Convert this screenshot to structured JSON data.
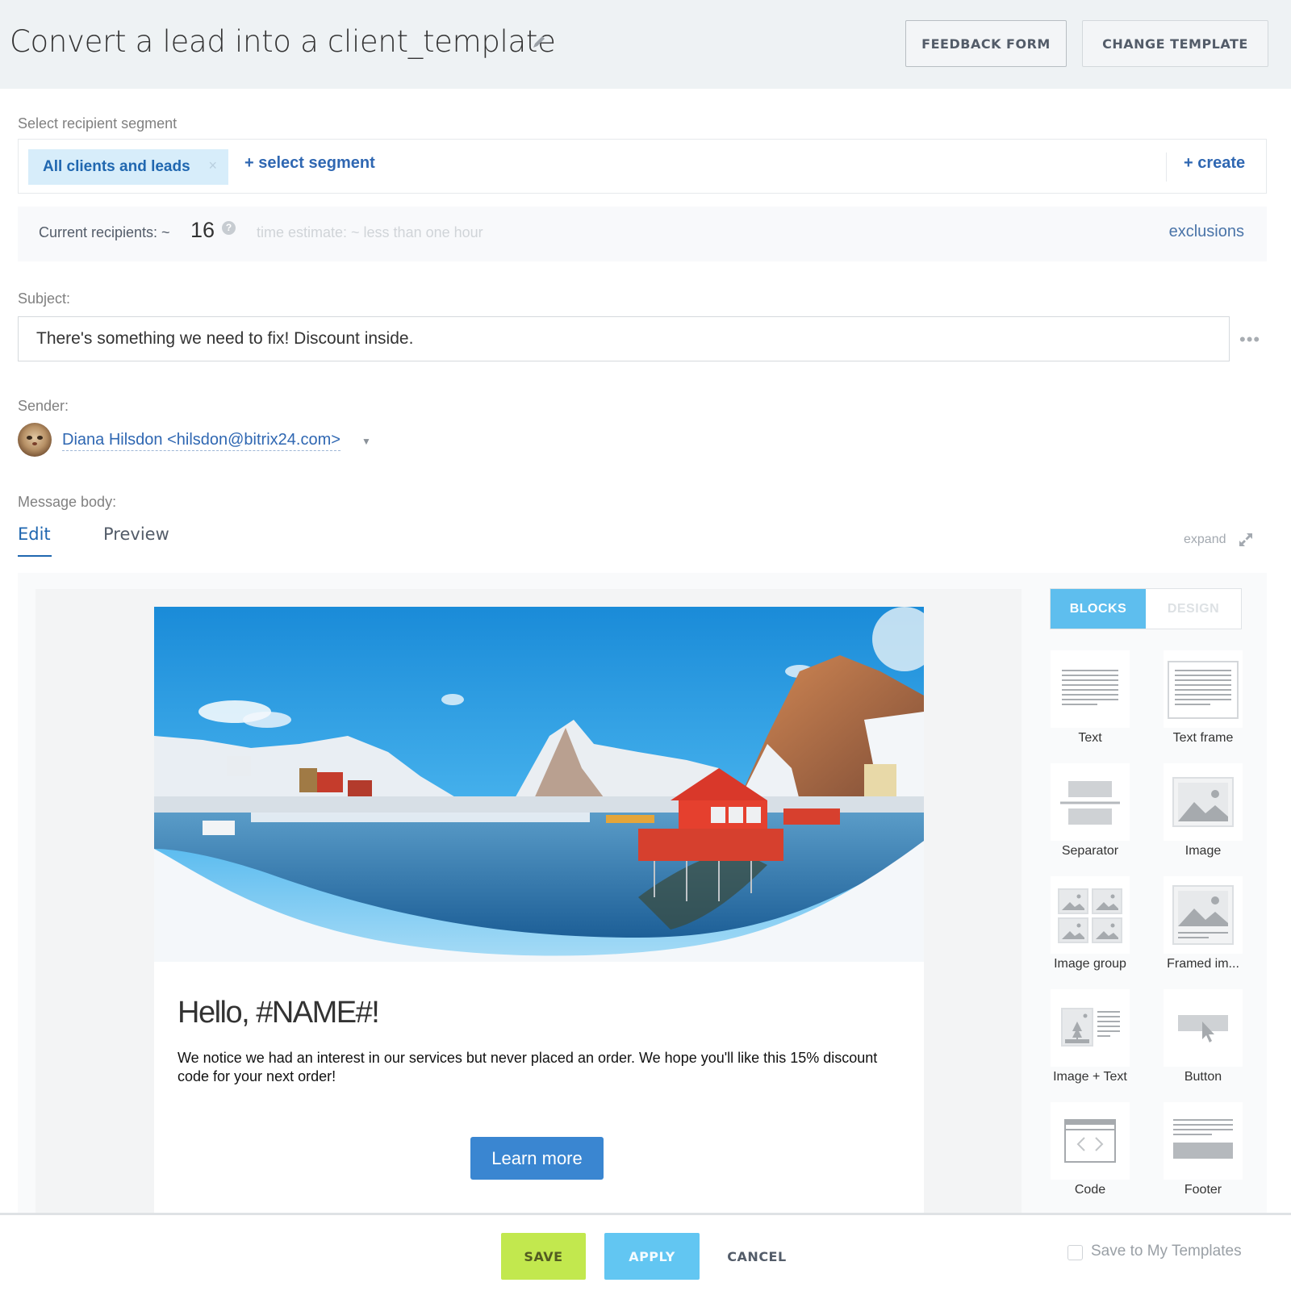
{
  "header": {
    "title": "Convert a lead into a client_template",
    "edit_icon": "pencil-icon",
    "buttons": {
      "feedback_form": "FEEDBACK FORM",
      "change_template": "CHANGE TEMPLATE"
    }
  },
  "segment": {
    "label": "Select recipient segment",
    "selected_chip": "All clients and leads",
    "chip_remove_glyph": "×",
    "select_link": "+ select segment",
    "create_link": "+ create"
  },
  "recipients": {
    "label": "Current recipients: ~",
    "count": "16",
    "help_glyph": "?",
    "time_estimate": "time estimate: ~ less than one hour",
    "exclusions_link": "exclusions"
  },
  "subject": {
    "label": "Subject:",
    "value": "There's something we need to fix! Discount inside.",
    "more_glyph": "•••"
  },
  "sender": {
    "label": "Sender:",
    "value": "Diana Hilsdon <hilsdon@bitrix24.com>",
    "caret_glyph": "▼"
  },
  "message_body": {
    "label": "Message body:",
    "tabs": [
      {
        "label": "Edit",
        "active": true
      },
      {
        "label": "Preview",
        "active": false
      }
    ],
    "expand_label": "expand"
  },
  "email": {
    "heading": "Hello, #NAME#!",
    "body": "We notice we had an interest in our services but never placed an order. We hope you'll like this 15% discount code for your next order!",
    "button_label": "Learn more"
  },
  "panel": {
    "tabs": [
      {
        "label": "BLOCKS",
        "active": true
      },
      {
        "label": "DESIGN",
        "active": false
      }
    ],
    "blocks": [
      {
        "label": "Text",
        "icon": "text-block-icon"
      },
      {
        "label": "Text frame",
        "icon": "text-frame-block-icon"
      },
      {
        "label": "Separator",
        "icon": "separator-block-icon"
      },
      {
        "label": "Image",
        "icon": "image-block-icon"
      },
      {
        "label": "Image group",
        "icon": "image-group-block-icon"
      },
      {
        "label": "Framed im...",
        "icon": "framed-image-block-icon"
      },
      {
        "label": "Image + Text",
        "icon": "image-text-block-icon"
      },
      {
        "label": "Button",
        "icon": "button-block-icon"
      },
      {
        "label": "Code",
        "icon": "code-block-icon"
      },
      {
        "label": "Footer",
        "icon": "footer-block-icon"
      }
    ]
  },
  "footer": {
    "save": "SAVE",
    "apply": "APPLY",
    "cancel": "CANCEL",
    "save_to_templates": "Save to My Templates",
    "save_to_templates_checked": false
  },
  "colors": {
    "accent_blue": "#2067b0",
    "save_green": "#c2e84e",
    "apply_blue": "#62c6f2",
    "blocks_tab_blue": "#5ebeee",
    "email_button": "#3a86d1",
    "header_bg": "#eef2f4"
  }
}
